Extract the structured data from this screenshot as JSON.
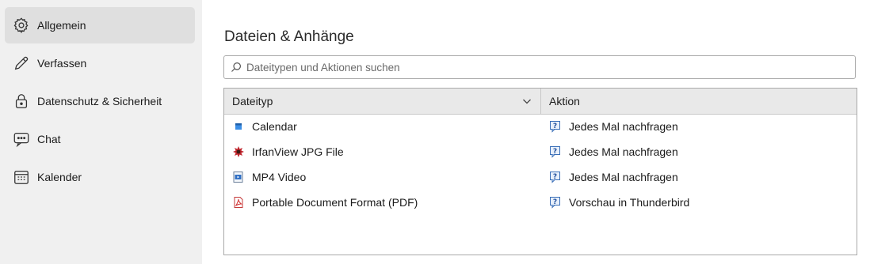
{
  "sidebar": {
    "items": [
      {
        "label": "Allgemein",
        "icon": "gear-icon",
        "active": true
      },
      {
        "label": "Verfassen",
        "icon": "pencil-icon",
        "active": false
      },
      {
        "label": "Datenschutz & Sicherheit",
        "icon": "lock-icon",
        "active": false
      },
      {
        "label": "Chat",
        "icon": "chat-bubble-icon",
        "active": false
      },
      {
        "label": "Kalender",
        "icon": "calendar-icon",
        "active": false
      }
    ]
  },
  "main": {
    "title": "Dateien & Anhänge",
    "search": {
      "placeholder": "Dateitypen und Aktionen suchen",
      "value": ""
    },
    "table": {
      "headers": {
        "filetype": "Dateityp",
        "action": "Aktion"
      },
      "rows": [
        {
          "filetype": "Calendar",
          "icon": "calendar-file-icon",
          "action": "Jedes Mal nachfragen",
          "action_icon": "ask-icon"
        },
        {
          "filetype": "IrfanView JPG File",
          "icon": "irfanview-icon",
          "action": "Jedes Mal nachfragen",
          "action_icon": "ask-icon"
        },
        {
          "filetype": "MP4 Video",
          "icon": "video-file-icon",
          "action": "Jedes Mal nachfragen",
          "action_icon": "ask-icon"
        },
        {
          "filetype": "Portable Document Format (PDF)",
          "icon": "pdf-icon",
          "action": "Vorschau in Thunderbird",
          "action_icon": "ask-icon"
        }
      ]
    }
  },
  "colors": {
    "sidebar_bg": "#f0f0f0",
    "active_bg": "#dfdfdf",
    "header_bg": "#e9e9e9",
    "border": "#a9a9a9"
  }
}
